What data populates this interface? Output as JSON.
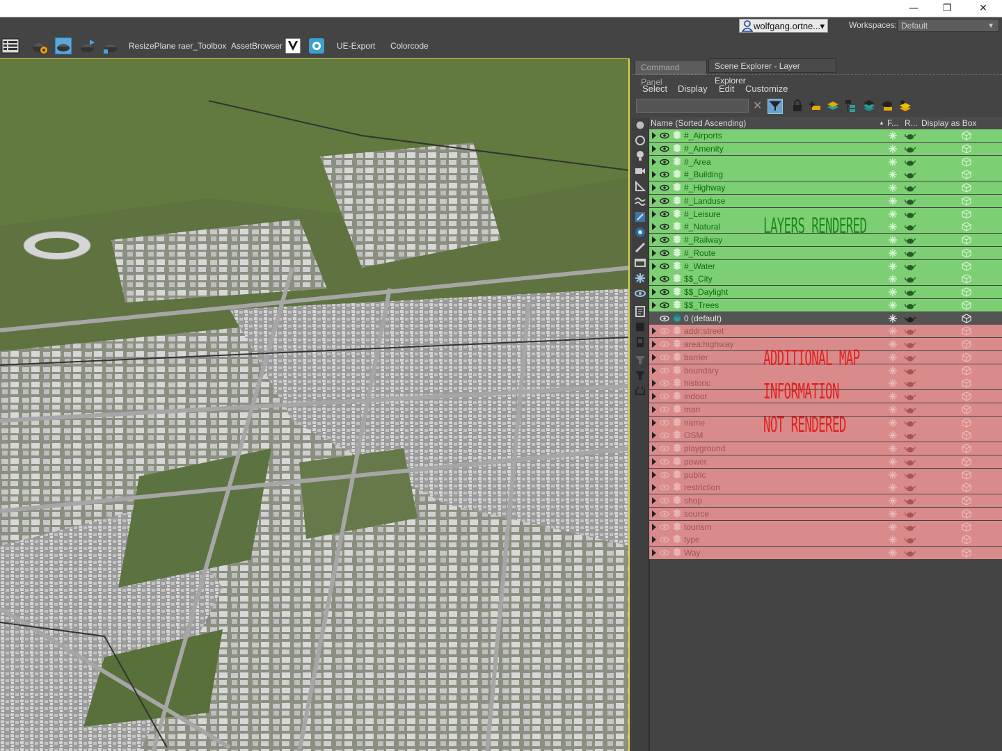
{
  "window": {
    "minimize_glyph": "—",
    "restore_glyph": "❐",
    "close_glyph": "✕"
  },
  "userbar": {
    "user_name": "wolfgang.ortne...",
    "user_menu_arrow": "▾",
    "workspaces_label": "Workspaces:",
    "workspace_value": "Default",
    "workspace_arrow": "▼"
  },
  "toolbar": {
    "icons": [
      "layer-manager-icon",
      "render-setup-icon",
      "render-frame-icon",
      "render-icon",
      "render-active-icon"
    ],
    "labels": {
      "resize_plane": "ResizePlane",
      "raer_toolbox": "raer_Toolbox",
      "asset_browser": "AssetBrowser",
      "ue_export": "UE-Export",
      "colorcode": "Colorcode"
    }
  },
  "panel": {
    "tabs": [
      "Command Panel",
      "Scene Explorer - Layer Explorer"
    ],
    "menus": [
      "Select",
      "Display",
      "Edit",
      "Customize"
    ],
    "search_value": "",
    "clear_glyph": "✕",
    "columns": {
      "name": "Name (Sorted Ascending)",
      "sort_arrow": "▲",
      "frozen": "F...",
      "render": "R...",
      "display_as_box": "Display as Box"
    },
    "annotations": {
      "rendered": "LAYERS RENDERED",
      "not_rendered_1": "ADDITIONAL MAP",
      "not_rendered_2": "INFORMATION",
      "not_rendered_3": "NOT RENDERED",
      "rendered_color": "#1a8a1a",
      "not_rendered_color": "#e0201e"
    },
    "colors": {
      "rendered_bg": "#7dcf74",
      "not_rendered_bg": "#d98b8b",
      "default_bg": "#545454"
    },
    "layers": [
      {
        "name": "#_Airports",
        "group": "rendered"
      },
      {
        "name": "#_Amenity",
        "group": "rendered"
      },
      {
        "name": "#_Area",
        "group": "rendered"
      },
      {
        "name": "#_Building",
        "group": "rendered"
      },
      {
        "name": "#_Highway",
        "group": "rendered"
      },
      {
        "name": "#_Landuse",
        "group": "rendered"
      },
      {
        "name": "#_Leisure",
        "group": "rendered"
      },
      {
        "name": "#_Natural",
        "group": "rendered"
      },
      {
        "name": "#_Railway",
        "group": "rendered"
      },
      {
        "name": "#_Route",
        "group": "rendered"
      },
      {
        "name": "#_Water",
        "group": "rendered"
      },
      {
        "name": "$$_City",
        "group": "rendered"
      },
      {
        "name": "$$_Daylight",
        "group": "rendered"
      },
      {
        "name": "$$_Trees",
        "group": "rendered"
      },
      {
        "name": "0 (default)",
        "group": "default"
      },
      {
        "name": "addr:street",
        "group": "not-rendered"
      },
      {
        "name": "area:highway",
        "group": "not-rendered"
      },
      {
        "name": "barrier",
        "group": "not-rendered"
      },
      {
        "name": "boundary",
        "group": "not-rendered"
      },
      {
        "name": "historic",
        "group": "not-rendered"
      },
      {
        "name": "indoor",
        "group": "not-rendered"
      },
      {
        "name": "man",
        "group": "not-rendered"
      },
      {
        "name": "name",
        "group": "not-rendered"
      },
      {
        "name": "OSM",
        "group": "not-rendered"
      },
      {
        "name": "playground",
        "group": "not-rendered"
      },
      {
        "name": "power",
        "group": "not-rendered"
      },
      {
        "name": "public",
        "group": "not-rendered"
      },
      {
        "name": "restriction",
        "group": "not-rendered"
      },
      {
        "name": "shop",
        "group": "not-rendered"
      },
      {
        "name": "source",
        "group": "not-rendered"
      },
      {
        "name": "tourism",
        "group": "not-rendered"
      },
      {
        "name": "type",
        "group": "not-rendered"
      },
      {
        "name": "Way",
        "group": "not-rendered"
      }
    ]
  }
}
